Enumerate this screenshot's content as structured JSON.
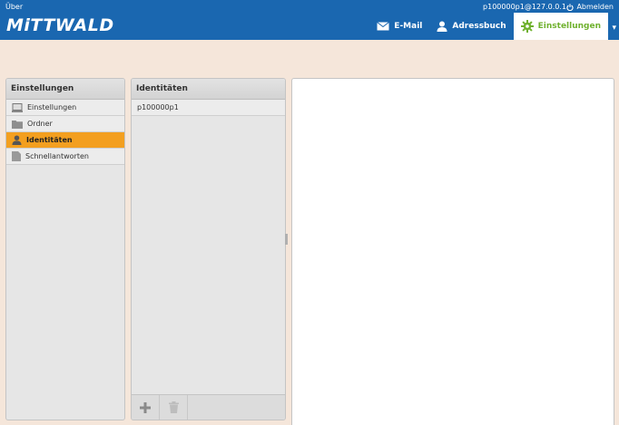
{
  "header": {
    "about_label": "Über",
    "user": "p100000p1@127.0.0.1",
    "logout_label": "Abmelden",
    "logo_text": "MiTTWALD",
    "nav": [
      {
        "label": "E-Mail",
        "icon": "envelope-icon"
      },
      {
        "label": "Adressbuch",
        "icon": "person-icon"
      },
      {
        "label": "Einstellungen",
        "icon": "gear-icon",
        "active": true
      }
    ]
  },
  "settings_panel": {
    "title": "Einstellungen",
    "items": [
      {
        "label": "Einstellungen",
        "icon": "computer-icon"
      },
      {
        "label": "Ordner",
        "icon": "folder-icon"
      },
      {
        "label": "Identitäten",
        "icon": "person-icon",
        "active": true
      },
      {
        "label": "Schnellantworten",
        "icon": "document-icon"
      }
    ]
  },
  "identities_panel": {
    "title": "Identitäten",
    "items": [
      {
        "label": "p100000p1"
      }
    ]
  },
  "colors": {
    "header_bg": "#1a67b0",
    "accent_orange": "#f39f1f",
    "accent_green": "#6fb12e",
    "page_bg": "#f5e6da"
  }
}
